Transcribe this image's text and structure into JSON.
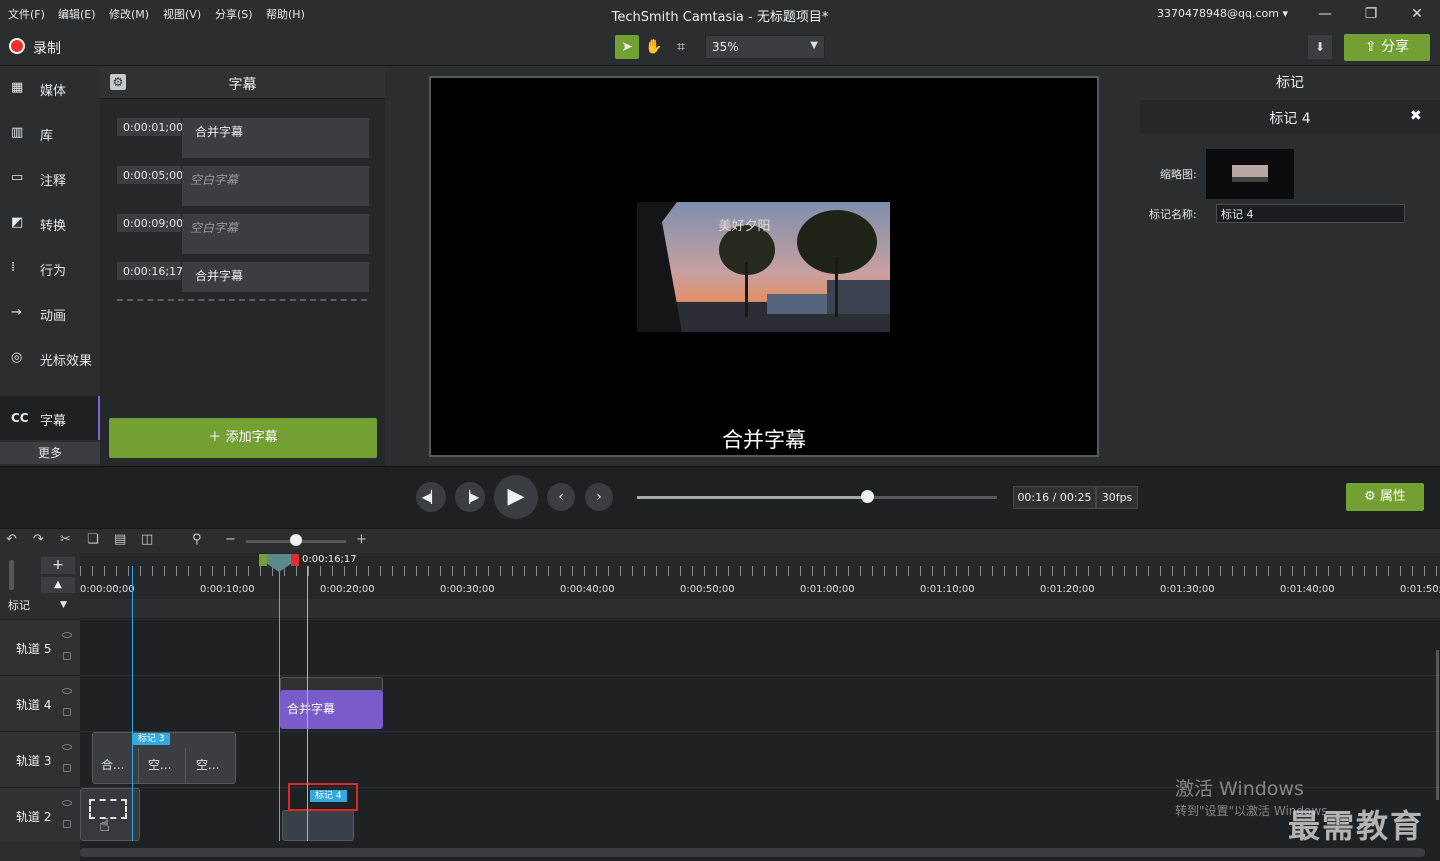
{
  "menu": [
    "文件(F)",
    "编辑(E)",
    "修改(M)",
    "视图(V)",
    "分享(S)",
    "帮助(H)"
  ],
  "app_title": "TechSmith Camtasia - 无标题项目*",
  "account": "3370478948@qq.com",
  "window_controls": {
    "minimize": "—",
    "restore": "❐",
    "close": "✕"
  },
  "toolbar": {
    "record_label": "录制",
    "zoom_value": "35%",
    "share_label": "分享",
    "accent_color": "#72a033"
  },
  "nav": {
    "items": [
      {
        "label": "媒体",
        "icon": "film-icon"
      },
      {
        "label": "库",
        "icon": "library-icon"
      },
      {
        "label": "注释",
        "icon": "annotation-icon"
      },
      {
        "label": "转换",
        "icon": "transition-icon"
      },
      {
        "label": "行为",
        "icon": "behavior-icon"
      },
      {
        "label": "动画",
        "icon": "animation-icon"
      },
      {
        "label": "光标效果",
        "icon": "cursor-effect-icon"
      },
      {
        "label": "字幕",
        "icon": "cc-icon"
      }
    ],
    "more_label": "更多",
    "cc_glyph": "CC"
  },
  "captions": {
    "title": "字幕",
    "rows": [
      {
        "time": "0:00:01;00",
        "text": "合并字幕",
        "empty": false
      },
      {
        "time": "0:00:05;00",
        "text": "空白字幕",
        "empty": true
      },
      {
        "time": "0:00:09;00",
        "text": "空白字幕",
        "empty": true
      },
      {
        "time": "0:00:16;17",
        "text": "合并字幕",
        "empty": false
      }
    ],
    "add_label": "添加字幕"
  },
  "canvas": {
    "overlay_text": "美好夕阳",
    "caption_text": "合并字幕"
  },
  "properties": {
    "title": "标记",
    "subtitle": "标记 4",
    "thumbnail_label": "缩略图:",
    "name_label": "标记名称:",
    "name_value": "标记 4"
  },
  "playback": {
    "time": "00:16 / 00:25",
    "fps": "30fps",
    "progress_fraction": 0.64,
    "props_label": "属性"
  },
  "timeline": {
    "playhead_time": "0:00:16;17",
    "ruler": [
      "0:00:00;00",
      "0:00:10;00",
      "0:00:20;00",
      "0:00:30;00",
      "0:00:40;00",
      "0:00:50;00",
      "0:01:00;00",
      "0:01:10;00",
      "0:01:20;00",
      "0:01:30;00",
      "0:01:40;00",
      "0:01:50;"
    ],
    "marker_label": "标记",
    "tracks": [
      "轨道 5",
      "轨道 4",
      "轨道 3",
      "轨道 2"
    ],
    "clip_purple": "合并字幕",
    "segments": [
      "合...",
      "空...",
      "空..."
    ],
    "marker3": "标记 3",
    "marker4": "标记 4",
    "zoom_fraction": 0.5
  },
  "watermark": {
    "line1": "激活 Windows",
    "line2": "转到\"设置\"以激活 Windows",
    "brand": "最需教育"
  }
}
